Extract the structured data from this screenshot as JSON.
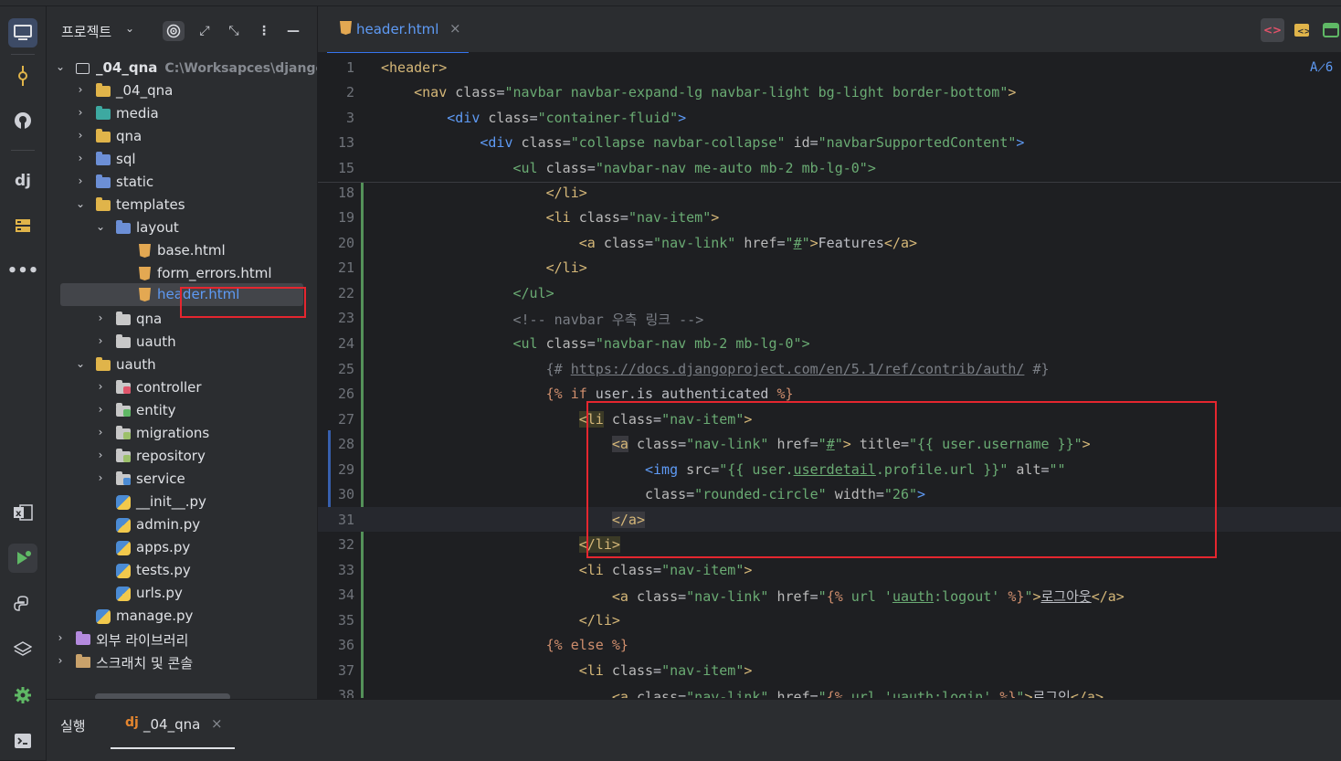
{
  "project_panel": {
    "title": "프로젝트",
    "tree": [
      {
        "label": "_04_qna",
        "path": "C:\\Worksapces\\django",
        "expanded": true
      },
      {
        "label": "_04_qna"
      },
      {
        "label": "media"
      },
      {
        "label": "qna"
      },
      {
        "label": "sql"
      },
      {
        "label": "static"
      },
      {
        "label": "templates"
      },
      {
        "label": "layout"
      },
      {
        "label": "base.html"
      },
      {
        "label": "form_errors.html"
      },
      {
        "label": "header.html"
      },
      {
        "label": "qna"
      },
      {
        "label": "uauth"
      },
      {
        "label": "uauth"
      },
      {
        "label": "controller"
      },
      {
        "label": "entity"
      },
      {
        "label": "migrations"
      },
      {
        "label": "repository"
      },
      {
        "label": "service"
      },
      {
        "label": "__init__.py"
      },
      {
        "label": "admin.py"
      },
      {
        "label": "apps.py"
      },
      {
        "label": "tests.py"
      },
      {
        "label": "urls.py"
      },
      {
        "label": "manage.py"
      },
      {
        "label": "외부 라이브러리"
      },
      {
        "label": "스크래치 및 콘솔"
      }
    ]
  },
  "editor": {
    "tab_label": "header.html",
    "inlay_hint": "A̷6",
    "sticky_lines": [
      {
        "n": "1"
      },
      {
        "n": "2"
      },
      {
        "n": "3"
      },
      {
        "n": "13"
      },
      {
        "n": "15"
      }
    ],
    "lines": [
      {
        "n": "18"
      },
      {
        "n": "19"
      },
      {
        "n": "20"
      },
      {
        "n": "21"
      },
      {
        "n": "22"
      },
      {
        "n": "23"
      },
      {
        "n": "24"
      },
      {
        "n": "25"
      },
      {
        "n": "26"
      },
      {
        "n": "27"
      },
      {
        "n": "28"
      },
      {
        "n": "29"
      },
      {
        "n": "30"
      },
      {
        "n": "31"
      },
      {
        "n": "32"
      },
      {
        "n": "33"
      },
      {
        "n": "34"
      },
      {
        "n": "35"
      },
      {
        "n": "36"
      },
      {
        "n": "37"
      },
      {
        "n": "38"
      }
    ]
  },
  "bottom_panel": {
    "run_label": "실행",
    "run_tab_icon": "dj",
    "run_tab_label": "_04_qna"
  },
  "colors": {
    "accent": "#3574f0",
    "highlight_box": "#e5262f",
    "tag": "#d5b778",
    "string": "#6aab73",
    "comment": "#7a7e85"
  }
}
